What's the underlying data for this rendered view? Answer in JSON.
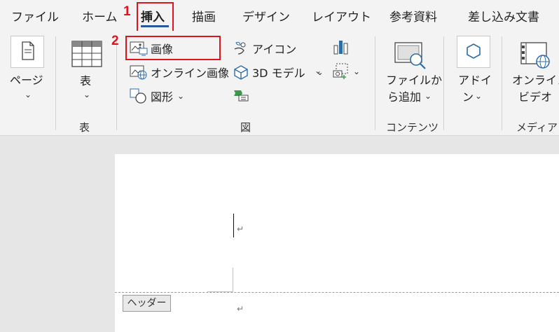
{
  "tabs": [
    {
      "label": "ファイル"
    },
    {
      "label": "ホーム"
    },
    {
      "label": "挿入"
    },
    {
      "label": "描画"
    },
    {
      "label": "デザイン"
    },
    {
      "label": "レイアウト"
    },
    {
      "label": "参考資料"
    },
    {
      "label": "差し込み文書"
    }
  ],
  "steps": {
    "one": "1",
    "two": "2"
  },
  "ribbon": {
    "pages": {
      "label": "ページ"
    },
    "table": {
      "label": "表",
      "group": "表"
    },
    "illustrations": {
      "group": "図",
      "image": "画像",
      "online_image": "オンライン画像",
      "shapes": "図形",
      "icons": "アイコン",
      "models_3d": "3D モデル"
    },
    "content": {
      "label_line1": "ファイルか",
      "label_line2": "ら追加",
      "group": "コンテンツ"
    },
    "addins": {
      "label_line1": "アドイ",
      "label_line2": "ン"
    },
    "media": {
      "label_line1": "オンライン",
      "label_line2": "ビデオ",
      "group": "メディア"
    }
  },
  "document": {
    "header_tag": "ヘッダー",
    "para_mark": "↵"
  },
  "colors": {
    "accent": "#2b579a",
    "highlight": "#e0141e",
    "icon_blue": "#2e6ca4"
  }
}
